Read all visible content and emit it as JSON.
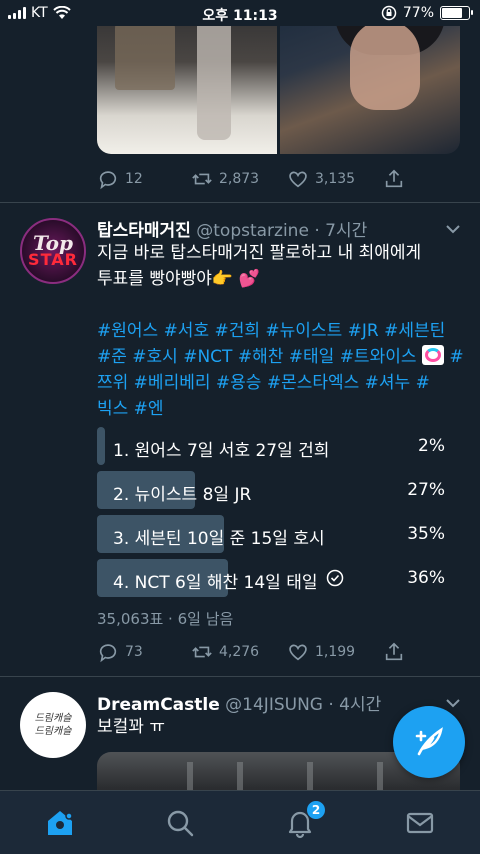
{
  "status_bar": {
    "carrier": "KT",
    "time": "오후 11:13",
    "battery": "77%",
    "battery_level": 0.77
  },
  "prev_tweet": {
    "replies": "12",
    "retweets": "2,873",
    "likes": "3,135"
  },
  "tweet1": {
    "name": "탑스타매거진",
    "handle": "@topstarzine",
    "time": "· 7시간",
    "avatar_text_1": "Top",
    "avatar_text_2": "STAR",
    "line1": "지금 바로 탑스타매거진 팔로하고 내 최애에게",
    "line2": "투표를 빵야빵야👉 💕",
    "hashtags_line1": "#원어스 #서호 #건희 #뉴이스트 #JR #세븐틴",
    "hashtags_line2": "#준 #호시 #NCT #해찬 #태일 #트와이스",
    "hashtags_line2_tail": "#",
    "hashtags_line3": "쯔위 #베리베리 #용승 #몬스타엑스 #셔누 #",
    "hashtags_line4": "빅스 #엔",
    "poll": [
      {
        "label": "1. 원어스 7일 서호 27일 건희",
        "pct": "2%",
        "share": 0.02
      },
      {
        "label": "2. 뉴이스트 8일 JR",
        "pct": "27%",
        "share": 0.27
      },
      {
        "label": "3. 세븐틴 10일 준 15일 호시",
        "pct": "35%",
        "share": 0.35
      },
      {
        "label": "4. NCT 6일 해찬 14일 태일",
        "pct": "36%",
        "share": 0.36
      }
    ],
    "poll_meta": "35,063표 · 6일 남음",
    "replies": "73",
    "retweets": "4,276",
    "likes": "1,199"
  },
  "tweet2": {
    "name": "DreamCastle",
    "handle": "@14JISUNG",
    "time": "· 4시간",
    "text": "보컬꽈 ㅠ",
    "avatar_text_1": "드림캐슬",
    "avatar_text_2": "드림캐슬"
  },
  "tabbar": {
    "notifications_badge": "2"
  },
  "colors": {
    "background": "#15202b",
    "accent": "#1da1f2",
    "muted": "#8899a6",
    "poll_bar": "#3d5466"
  }
}
